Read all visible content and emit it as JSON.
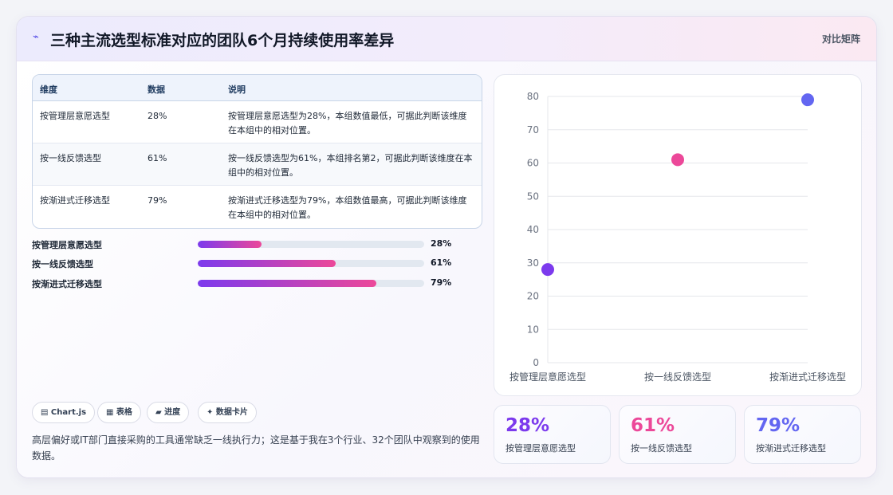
{
  "header": {
    "icon": "sparkline-icon",
    "title": "三种主流选型标准对应的团队6个月持续使用率差异",
    "tag": "对比矩阵"
  },
  "table": {
    "columns": [
      "维度",
      "数据",
      "说明"
    ],
    "rows": [
      {
        "dim": "按管理层意愿选型",
        "value": "28%",
        "desc": "按管理层意愿选型为28%，本组数值最低，可据此判断该维度在本组中的相对位置。"
      },
      {
        "dim": "按一线反馈选型",
        "value": "61%",
        "desc": "按一线反馈选型为61%，本组排名第2，可据此判断该维度在本组中的相对位置。"
      },
      {
        "dim": "按渐进式迁移选型",
        "value": "79%",
        "desc": "按渐进式迁移选型为79%，本组数值最高，可据此判断该维度在本组中的相对位置。"
      }
    ]
  },
  "progress": [
    {
      "label": "按管理层意愿选型",
      "value": "28%",
      "fraction": 0.28
    },
    {
      "label": "按一线反馈选型",
      "value": "61%",
      "fraction": 0.61
    },
    {
      "label": "按渐进式迁移选型",
      "value": "79%",
      "fraction": 0.79
    }
  ],
  "chips": [
    "▤ Chart.js",
    "▦ 表格",
    "▰ 进度",
    "✦ 数据卡片"
  ],
  "note": "高层偏好或IT部门直接采购的工具通常缺乏一线执行力；这是基于我在3个行业、32个团队中观察到的使用数据。",
  "stats": [
    {
      "value": "28%",
      "label": "按管理层意愿选型",
      "color": "#7c3aed"
    },
    {
      "value": "61%",
      "label": "按一线反馈选型",
      "color": "#ec4899"
    },
    {
      "value": "79%",
      "label": "按渐进式迁移选型",
      "color": "#6366f1"
    }
  ],
  "chart_data": {
    "type": "scatter",
    "categories": [
      "按管理层意愿选型",
      "按一线反馈选型",
      "按渐进式迁移选型"
    ],
    "values": [
      28,
      61,
      79
    ],
    "point_colors": [
      "#7c3aed",
      "#ec4899",
      "#6366f1"
    ],
    "ylim": [
      0,
      80
    ],
    "yticks": [
      0,
      10,
      20,
      30,
      40,
      50,
      60,
      70,
      80
    ],
    "grid": true,
    "legend": "none"
  }
}
